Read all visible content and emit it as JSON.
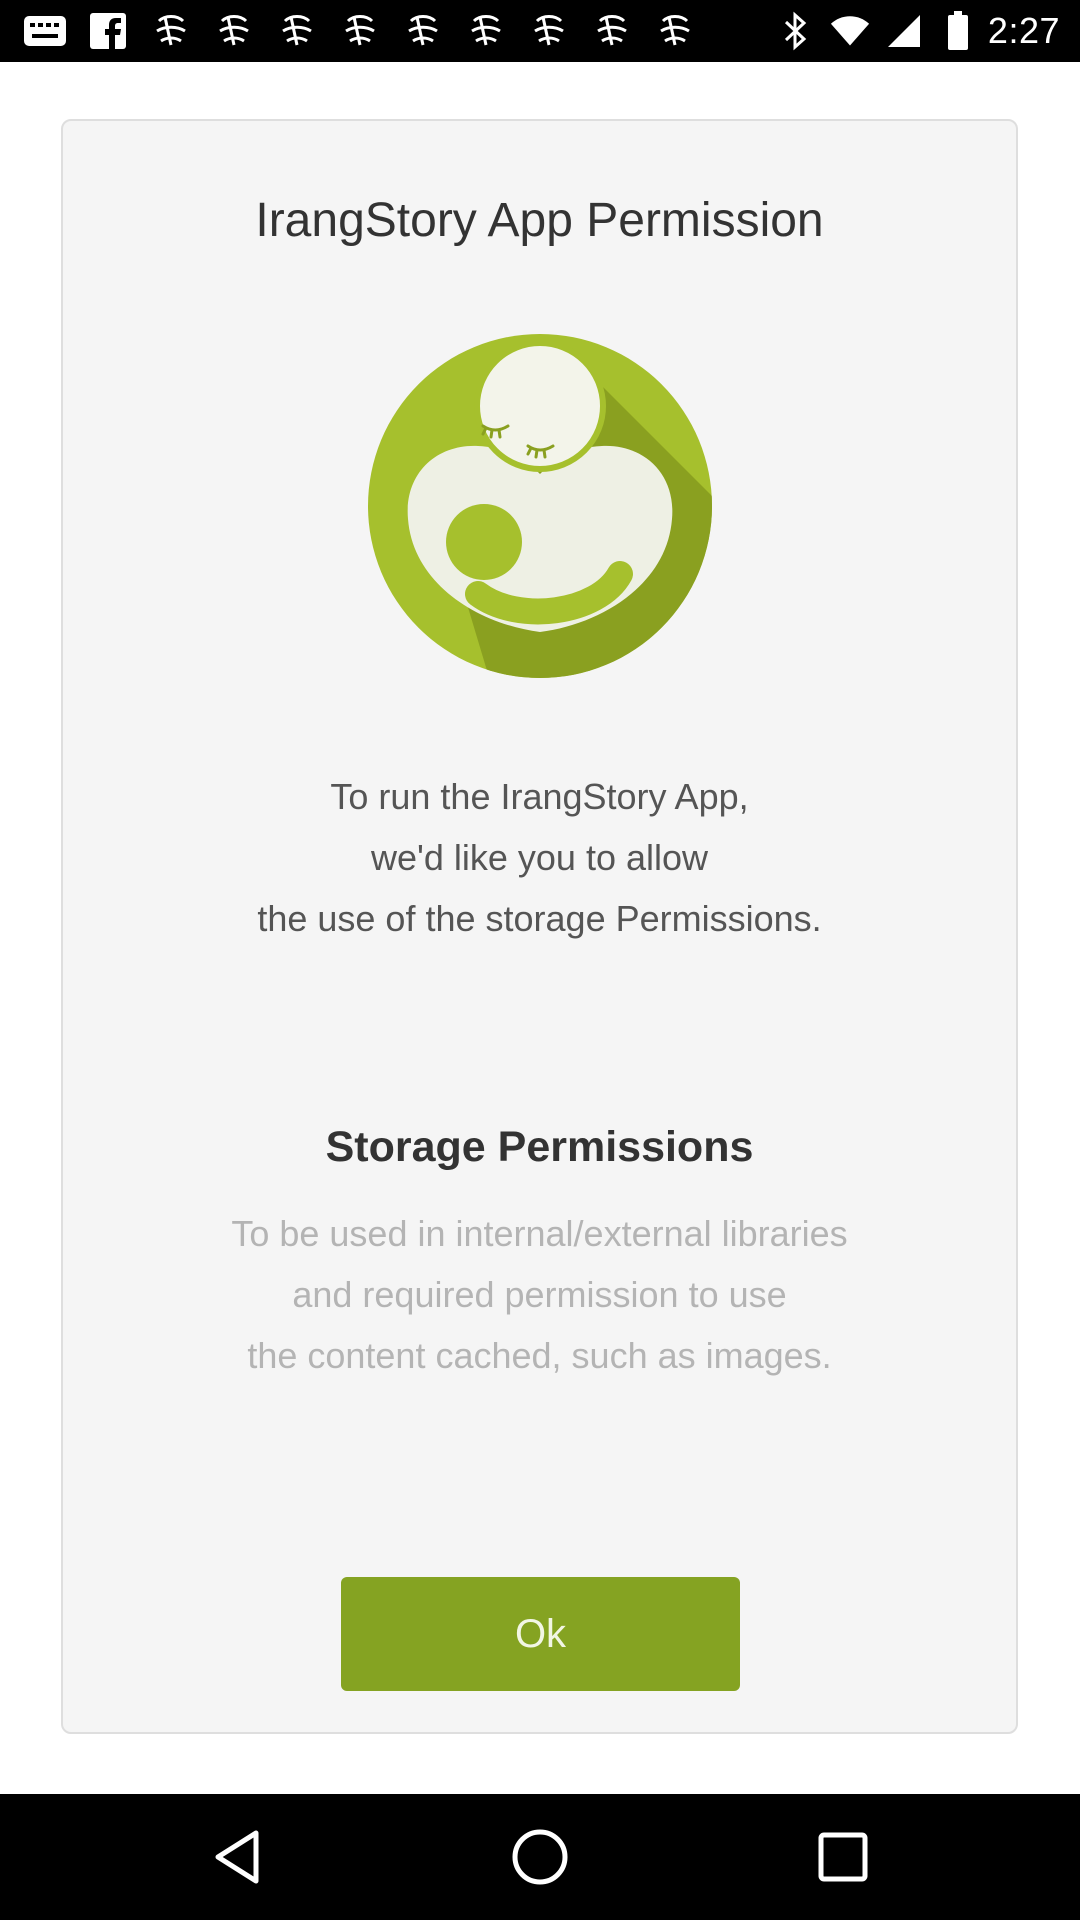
{
  "status_bar": {
    "left_icons": [
      "app-notification-icon",
      "facebook-icon",
      "app-notification-icon",
      "app-notification-icon",
      "app-notification-icon",
      "app-notification-icon",
      "app-notification-icon",
      "app-notification-icon",
      "app-notification-icon",
      "app-notification-icon",
      "app-notification-icon"
    ],
    "right_icons": [
      "bluetooth-icon",
      "wifi-icon",
      "signal-icon",
      "battery-icon"
    ],
    "time": "2:27"
  },
  "dialog": {
    "title": "IrangStory App Permission",
    "logo": "irangstory-logo",
    "intro_lines": [
      "To run the IrangStory App,",
      "we'd like you to allow",
      "the use of the storage Permissions."
    ],
    "permission_title": "Storage Permissions",
    "permission_desc_lines": [
      "To be used in internal/external libraries",
      "and required permission to use",
      "the content cached, such as images."
    ],
    "ok_label": "Ok",
    "colors": {
      "accent": "#85a322",
      "logo_circle": "#a6c02d",
      "logo_shadow": "#8aa020",
      "logo_figure": "#eef0e4"
    }
  },
  "nav_bar": {
    "buttons": [
      "back-icon",
      "home-icon",
      "recents-icon"
    ]
  }
}
